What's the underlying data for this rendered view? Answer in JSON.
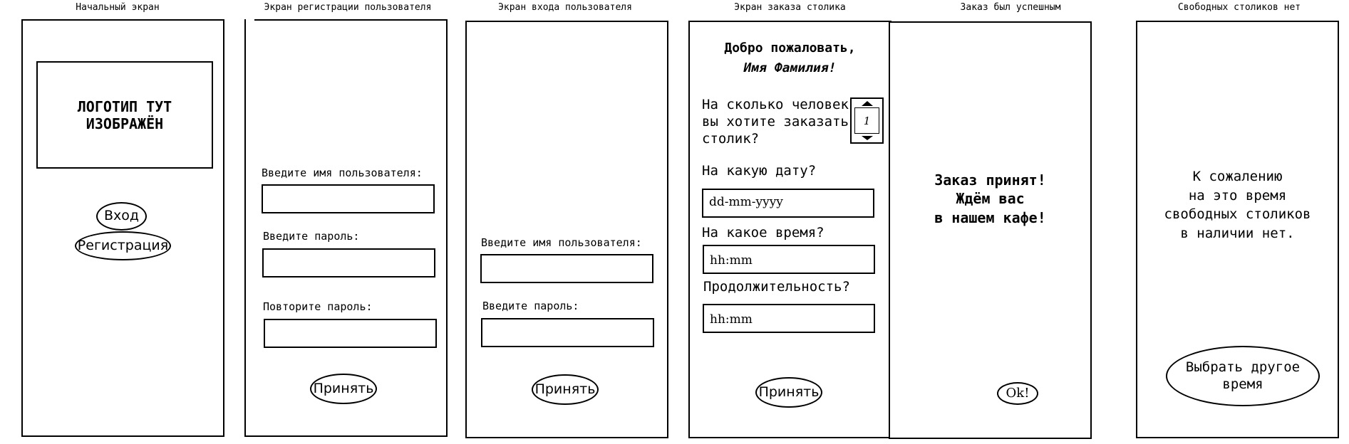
{
  "screens": [
    {
      "title": "Начальный экран",
      "logo_text": "ЛОГОТИП ТУТ\nИЗОБРАЖЁН",
      "login_button": "Вход",
      "register_button": "Регистрация"
    },
    {
      "title": "Экран регистрации пользователя",
      "username_label": "Введите имя пользователя:",
      "password_label": "Введите пароль:",
      "repeat_password_label": "Повторите пароль:",
      "accept_button": "Принять"
    },
    {
      "title": "Экран входа пользователя",
      "username_label": "Введите имя пользователя:",
      "password_label": "Введите пароль:",
      "accept_button": "Принять"
    },
    {
      "title": "Экран заказа столика",
      "welcome_line1": "Добро пожаловать,",
      "welcome_line2": "Имя Фамилия!",
      "people_question": "На сколько человек\nвы хотите заказать\nстолик?",
      "people_value": "1",
      "date_question": "На какую дату?",
      "date_placeholder": "dd-mm-yyyy",
      "time_question": "На какое время?",
      "time_placeholder": "hh:mm",
      "duration_question": "Продолжительность?",
      "duration_placeholder": "hh:mm",
      "accept_button": "Принять"
    },
    {
      "title": "Заказ был успешным",
      "message": "Заказ принят!\nЖдём вас\nв нашем кафе!",
      "ok_button": "Ok!"
    },
    {
      "title": "Свободных столиков нет",
      "message": "К сожалению\nна это время\nсвободных столиков\nв наличии нет.",
      "choose_button": "Выбрать другое\nвремя"
    }
  ]
}
